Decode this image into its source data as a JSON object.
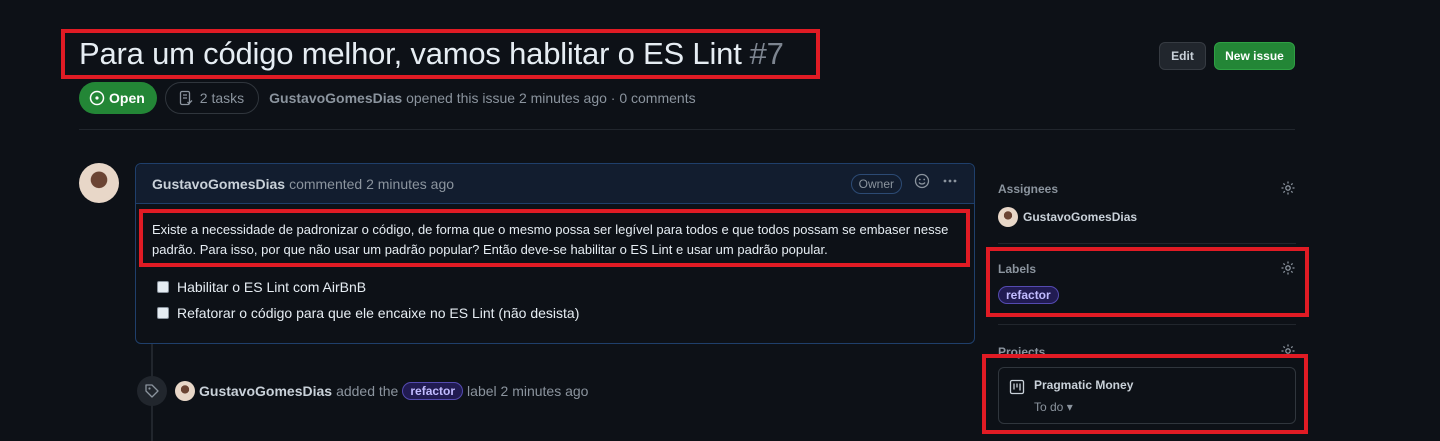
{
  "issue": {
    "title": "Para um código melhor, vamos hablitar o ES Lint",
    "number": "#7",
    "state": "Open",
    "tasks": "2 tasks",
    "author": "GustavoGomesDias",
    "opened_text": "opened this issue 2 minutes ago · 0 comments"
  },
  "actions": {
    "edit": "Edit",
    "new_issue": "New issue"
  },
  "comment": {
    "author": "GustavoGomesDias",
    "time": "commented 2 minutes ago",
    "role": "Owner",
    "body": "Existe a necessidade de padronizar o código, de forma que o mesmo possa ser legível para todos e que todos possam se embaser nesse padrão. Para isso, por que não usar um padrão popular? Então deve-se habilitar o ES Lint e usar um padrão popular.",
    "tasks": [
      "Habilitar o ES Lint com AirBnB",
      "Refatorar o código para que ele encaixe no ES Lint (não desista)"
    ]
  },
  "event": {
    "actor": "GustavoGomesDias",
    "pre": "added the",
    "label": "refactor",
    "post": "label 2 minutes ago"
  },
  "sidebar": {
    "assignees_title": "Assignees",
    "assignee": "GustavoGomesDias",
    "labels_title": "Labels",
    "label": "refactor",
    "projects_title": "Projects",
    "project_name": "Pragmatic Money",
    "project_status": "To do ▾"
  },
  "colors": {
    "accent_green": "#238636",
    "highlight": "#e01b24",
    "label_bg": "#211b52"
  }
}
